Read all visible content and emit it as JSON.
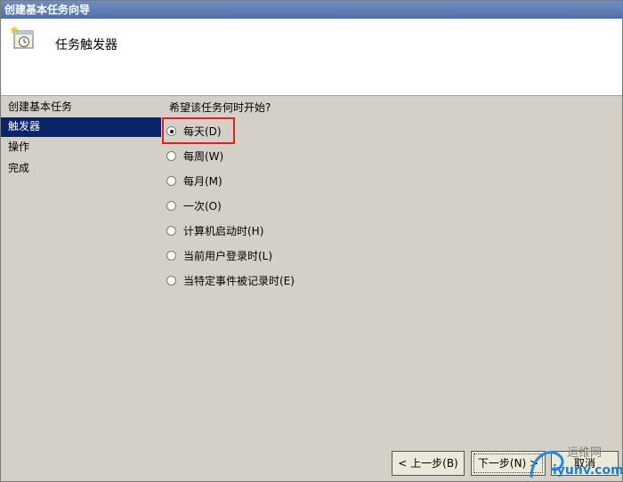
{
  "window": {
    "title": "创建基本任务向导"
  },
  "header": {
    "title": "任务触发器",
    "icon": "task-clock-icon"
  },
  "sidebar": {
    "items": [
      {
        "label": "创建基本任务"
      },
      {
        "label": "触发器"
      },
      {
        "label": "操作"
      },
      {
        "label": "完成"
      }
    ]
  },
  "main": {
    "question": "希望该任务何时开始?",
    "options": [
      {
        "label": "每天(D)",
        "checked": true
      },
      {
        "label": "每周(W)",
        "checked": false
      },
      {
        "label": "每月(M)",
        "checked": false
      },
      {
        "label": "一次(O)",
        "checked": false
      },
      {
        "label": "计算机启动时(H)",
        "checked": false
      },
      {
        "label": "当前用户登录时(L)",
        "checked": false
      },
      {
        "label": "当特定事件被记录时(E)",
        "checked": false
      }
    ]
  },
  "buttons": {
    "back": "< 上一步(B)",
    "next": "下一步(N) >",
    "cancel": "取消"
  },
  "watermark": {
    "text1": "运维网",
    "text2": "iyunv.com"
  },
  "colors": {
    "selection": "#0a246a",
    "highlight": "#e02020",
    "window_bg": "#d4d0c8"
  }
}
